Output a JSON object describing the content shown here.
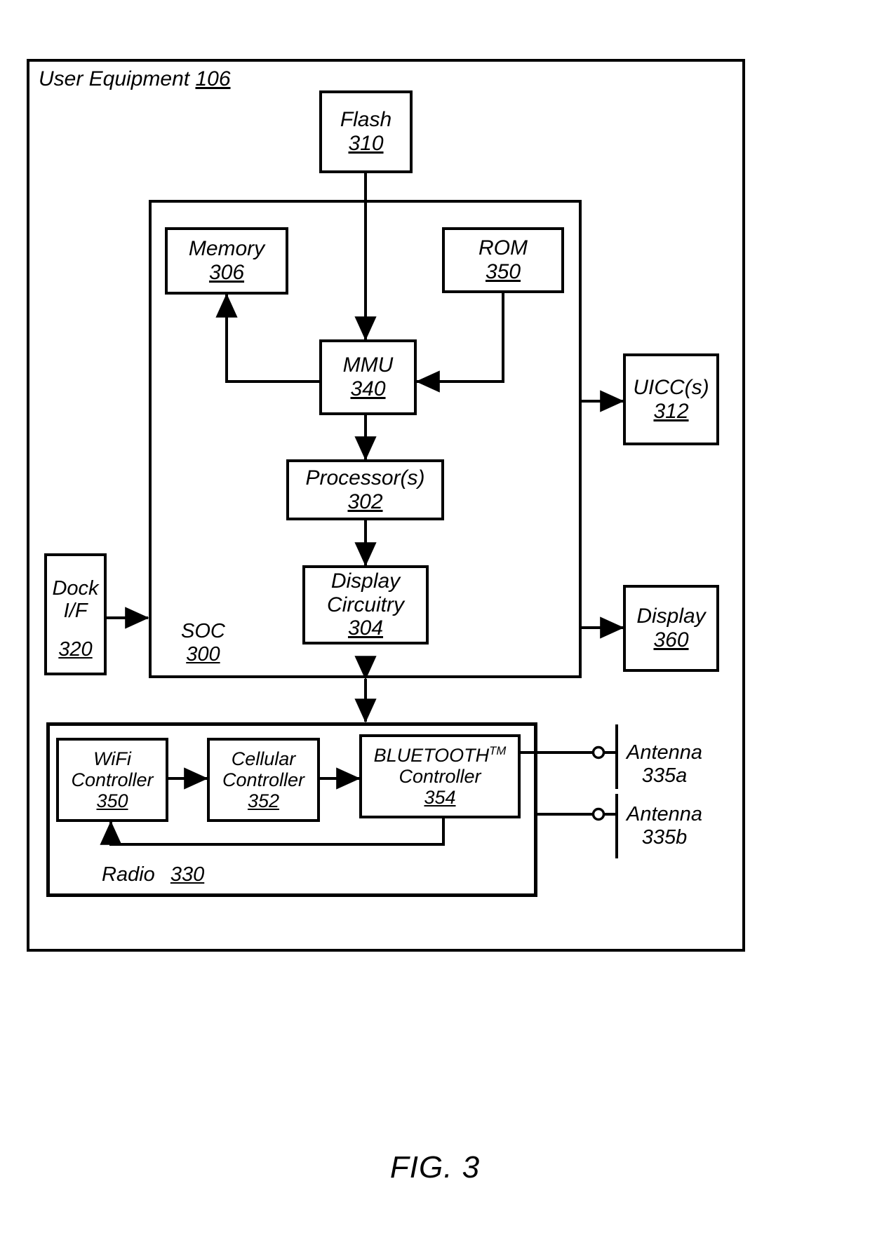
{
  "figure": {
    "caption": "FIG. 3"
  },
  "outer": {
    "label": "User Equipment",
    "ref": "106"
  },
  "soc": {
    "label": "SOC",
    "ref": "300"
  },
  "radio": {
    "label": "Radio",
    "ref": "330"
  },
  "blocks": {
    "flash": {
      "label": "Flash",
      "ref": "310"
    },
    "memory": {
      "label": "Memory",
      "ref": "306"
    },
    "rom": {
      "label": "ROM",
      "ref": "350"
    },
    "mmu": {
      "label": "MMU",
      "ref": "340"
    },
    "processor": {
      "label": "Processor(s)",
      "ref": "302"
    },
    "display_circuitry": {
      "label_line1": "Display",
      "label_line2": "Circuitry",
      "ref": "304"
    },
    "uicc": {
      "label": "UICC(s)",
      "ref": "312"
    },
    "display": {
      "label": "Display",
      "ref": "360"
    },
    "dock": {
      "label_line1": "Dock",
      "label_line2": "I/F",
      "ref": "320"
    },
    "wifi_controller": {
      "label_line1": "WiFi",
      "label_line2": "Controller",
      "ref": "350"
    },
    "cellular_controller": {
      "label_line1": "Cellular",
      "label_line2": "Controller",
      "ref": "352"
    },
    "bluetooth_controller": {
      "label_line1": "BLUETOOTH",
      "trademark": "TM",
      "label_line2": "Controller",
      "ref": "354"
    }
  },
  "antennas": [
    {
      "label": "Antenna",
      "ref": "335a"
    },
    {
      "label": "Antenna",
      "ref": "335b"
    }
  ],
  "colors": {
    "stroke": "#000000",
    "background": "#ffffff"
  }
}
